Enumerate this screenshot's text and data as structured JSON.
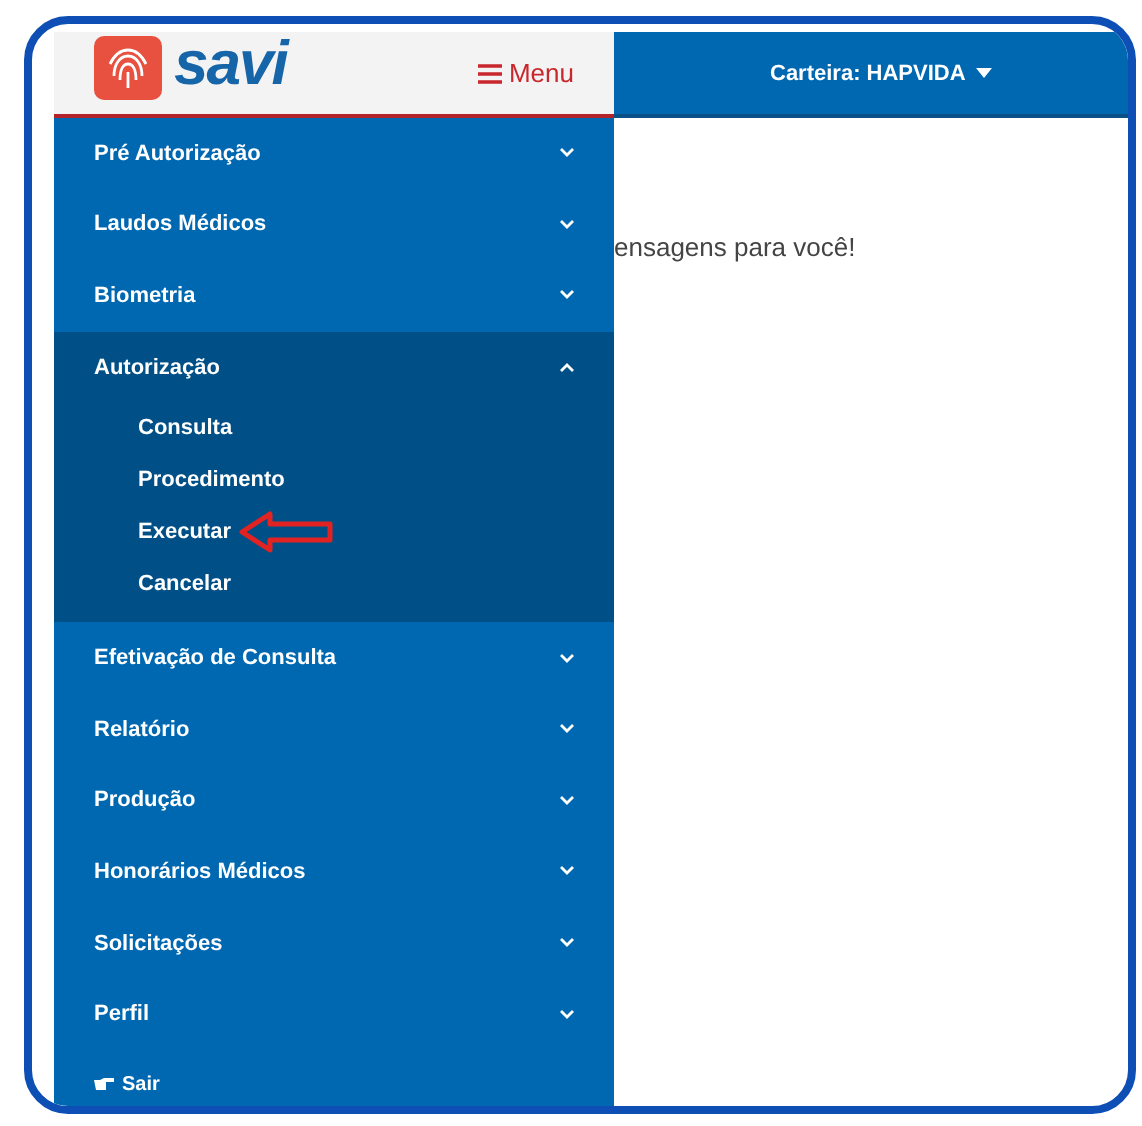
{
  "logo": {
    "text": "savi"
  },
  "menu_button": {
    "label": "Menu"
  },
  "top_bar": {
    "wallet": "Carteira: HAPVIDA"
  },
  "sidebar": {
    "items": [
      {
        "label": "Pré Autorização",
        "expanded": false
      },
      {
        "label": "Laudos Médicos",
        "expanded": false
      },
      {
        "label": "Biometria",
        "expanded": false
      },
      {
        "label": "Autorização",
        "expanded": true,
        "children": [
          {
            "label": "Consulta",
            "pointed": false
          },
          {
            "label": "Procedimento",
            "pointed": false
          },
          {
            "label": "Executar",
            "pointed": true
          },
          {
            "label": "Cancelar",
            "pointed": false
          }
        ]
      },
      {
        "label": "Efetivação de Consulta",
        "expanded": false
      },
      {
        "label": "Relatório",
        "expanded": false
      },
      {
        "label": "Produção",
        "expanded": false
      },
      {
        "label": "Honorários Médicos",
        "expanded": false
      },
      {
        "label": "Solicitações",
        "expanded": false
      },
      {
        "label": "Perfil",
        "expanded": false
      }
    ],
    "logout": "Sair"
  },
  "main": {
    "message": "ensagens para você!"
  }
}
